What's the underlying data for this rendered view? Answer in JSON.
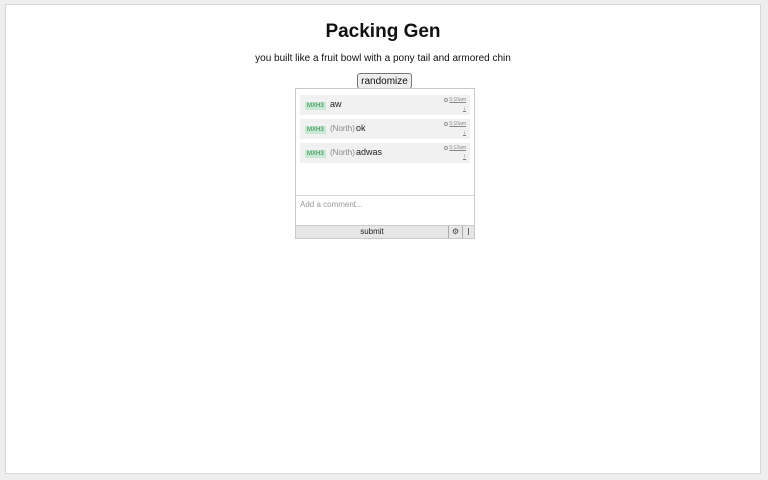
{
  "page": {
    "title": "Packing Gen",
    "subtitle": "you built like a fruit bowl with a pony tail and armored chin",
    "randomize_label": "randomize"
  },
  "comments_widget": {
    "comments": [
      {
        "badge": "MXH3",
        "region": "",
        "text": "aw",
        "time": "5:10am",
        "vote": "↓"
      },
      {
        "badge": "MXH3",
        "region": "(North)",
        "text": "ok",
        "time": "5:10am",
        "vote": "↓"
      },
      {
        "badge": "MXH3",
        "region": "(North)",
        "text": "adwas",
        "time": "5:12am",
        "vote": "↑"
      }
    ],
    "input_placeholder": "Add a comment...",
    "input_value": "",
    "submit_label": "submit",
    "settings_icon": "⚙",
    "menu_icon": "menu-icon"
  },
  "colors": {
    "background": "#eeeeee",
    "badge_bg": "#c7ebd2",
    "badge_text": "#2c7a45",
    "comment_bg": "#f1f1f1"
  }
}
